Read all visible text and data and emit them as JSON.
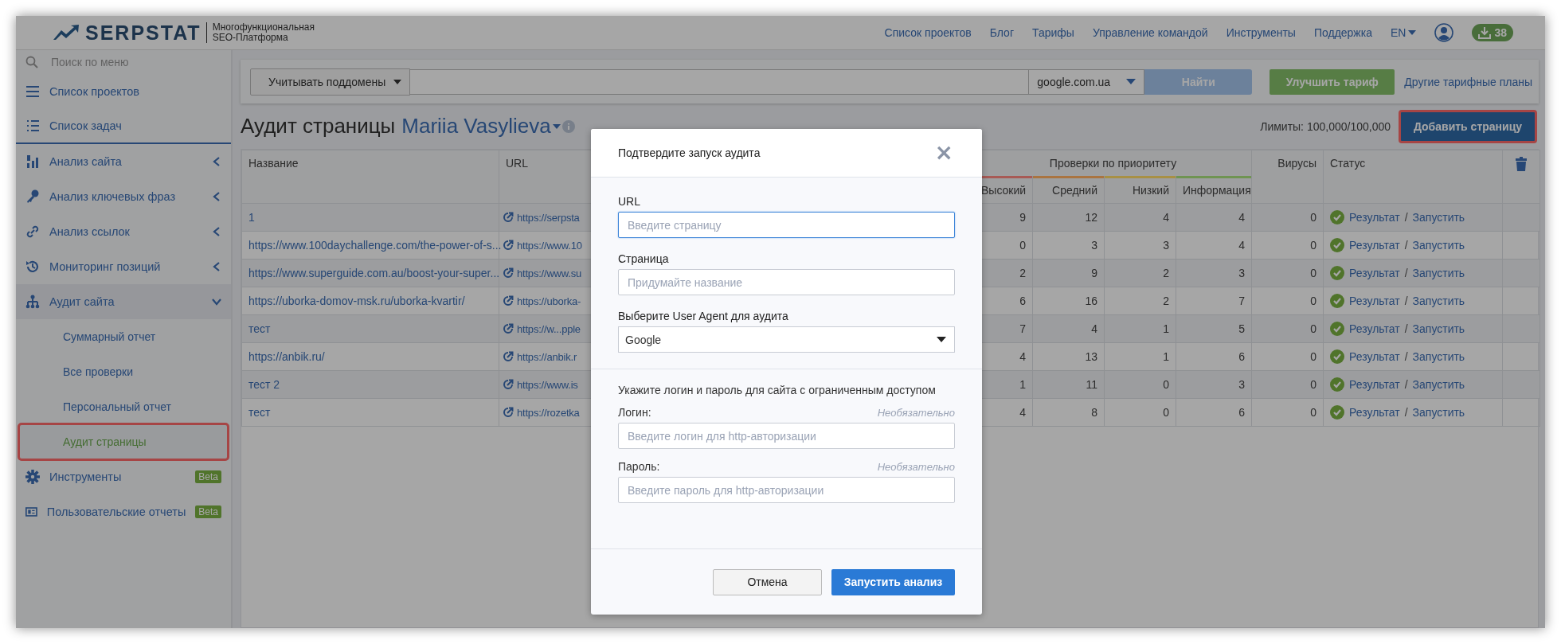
{
  "topbar": {
    "logo": "SERPSTAT",
    "tagline": "Многофункциональная\nSEO-Платформа",
    "nav": [
      "Список проектов",
      "Блог",
      "Тарифы",
      "Управление командой",
      "Инструменты",
      "Поддержка"
    ],
    "language": "EN",
    "downloads": "38"
  },
  "sidebar": {
    "search": {
      "placeholder": "Поиск по меню"
    },
    "items": [
      {
        "kind": "link",
        "label": "Список проектов"
      },
      {
        "kind": "link",
        "label": "Список задач"
      },
      {
        "kind": "group",
        "label": "Анализ сайта",
        "expanded": false
      },
      {
        "kind": "group",
        "label": "Анализ ключевых фраз",
        "expanded": false
      },
      {
        "kind": "group",
        "label": "Анализ ссылок",
        "expanded": false
      },
      {
        "kind": "group",
        "label": "Мониторинг позиций",
        "expanded": false
      },
      {
        "kind": "group",
        "label": "Аудит сайта",
        "expanded": true,
        "children": [
          {
            "label": "Суммарный отчет",
            "selected": false,
            "highlighted": false
          },
          {
            "label": "Все проверки",
            "selected": false,
            "highlighted": false
          },
          {
            "label": "Персональный отчет",
            "selected": false,
            "highlighted": false
          },
          {
            "label": "Аудит страницы",
            "selected": true,
            "highlighted": true
          }
        ]
      },
      {
        "kind": "link",
        "label": "Инструменты",
        "badge": "Beta"
      },
      {
        "kind": "link",
        "label": "Пользовательские отчеты",
        "badge": "Beta"
      }
    ]
  },
  "search_bar": {
    "scope": "Учитывать поддомены",
    "engine": "google.com.ua",
    "search_button": "Найти",
    "upgrade_button": "Улучшить тариф",
    "plans_link": "Другие тарифные планы"
  },
  "heading": {
    "title": "Аудит страницы",
    "project": "Mariia Vasylieva",
    "limits": "Лимиты: 100,000/100,000",
    "add_button": {
      "label": "Добавить страницу",
      "highlighted": true
    }
  },
  "table": {
    "columns": {
      "name": "Название",
      "url": "URL",
      "viruses": "Вирусы",
      "status": "Статус"
    },
    "priority_group": "Проверки по приоритету",
    "priority_columns": [
      {
        "label": "Высокий",
        "color": "#a85a55"
      },
      {
        "label": "Средний",
        "color": "#aa7440"
      },
      {
        "label": "Низкий",
        "color": "#a89044"
      },
      {
        "label": "Информация",
        "color": "#6f9452"
      }
    ],
    "rows": [
      {
        "name": "1",
        "url": "https://serpsta",
        "priority": [
          "9",
          "12",
          "4",
          "4"
        ],
        "viruses": "0",
        "status": {
          "result": "Результат",
          "separator": "/",
          "run": "Запустить"
        }
      },
      {
        "name": "https://www.100daychallenge.com/the-power-of-s...",
        "url": "https://www.10",
        "priority": [
          "0",
          "3",
          "3",
          "4"
        ],
        "viruses": "0",
        "status": {
          "result": "Результат",
          "separator": "/",
          "run": "Запустить"
        }
      },
      {
        "name": "https://www.superguide.com.au/boost-your-super...",
        "url": "https://www.su",
        "priority": [
          "2",
          "9",
          "2",
          "3"
        ],
        "viruses": "0",
        "status": {
          "result": "Результат",
          "separator": "/",
          "run": "Запустить"
        }
      },
      {
        "name": "https://uborka-domov-msk.ru/uborka-kvartir/",
        "url": "https://uborka-",
        "priority": [
          "6",
          "16",
          "2",
          "7"
        ],
        "viruses": "0",
        "status": {
          "result": "Результат",
          "separator": "/",
          "run": "Запустить"
        }
      },
      {
        "name": "тест",
        "url": "https://w...pple",
        "priority": [
          "7",
          "4",
          "1",
          "5"
        ],
        "viruses": "0",
        "status": {
          "result": "Результат",
          "separator": "/",
          "run": "Запустить"
        }
      },
      {
        "name": "https://anbik.ru/",
        "url": "https://anbik.r",
        "priority": [
          "4",
          "13",
          "1",
          "6"
        ],
        "viruses": "0",
        "status": {
          "result": "Результат",
          "separator": "/",
          "run": "Запустить"
        }
      },
      {
        "name": "тест 2",
        "url": "https://www.is",
        "priority": [
          "1",
          "11",
          "0",
          "3"
        ],
        "viruses": "0",
        "status": {
          "result": "Результат",
          "separator": "/",
          "run": "Запустить"
        }
      },
      {
        "name": "тест",
        "url": "https://rozetka",
        "priority": [
          "4",
          "8",
          "0",
          "6"
        ],
        "viruses": "0",
        "status": {
          "result": "Результат",
          "separator": "/",
          "run": "Запустить"
        }
      }
    ]
  },
  "dialog": {
    "title": "Подтвердите запуск аудита",
    "close": "×",
    "fields": [
      {
        "kind": "text",
        "label": "URL",
        "placeholder": "Введите страницу",
        "focused": true
      },
      {
        "kind": "text",
        "label": "Страница",
        "placeholder": "Придумайте название",
        "focused": false
      },
      {
        "kind": "select",
        "label": "Выберите User Agent для аудита",
        "value": "Google"
      }
    ],
    "auth": {
      "note": "Укажите логин и пароль для сайта с ограниченным доступом",
      "fields": [
        {
          "label": "Логин:",
          "hint": "Необязательно",
          "placeholder": "Введите логин для http-авторизации"
        },
        {
          "label": "Пароль:",
          "hint": "Необязательно",
          "placeholder": "Введите пароль для http-авторизации"
        }
      ]
    },
    "buttons": [
      {
        "kind": "secondary",
        "label": "Отмена"
      },
      {
        "kind": "primary",
        "label": "Запустить анализ"
      }
    ]
  }
}
